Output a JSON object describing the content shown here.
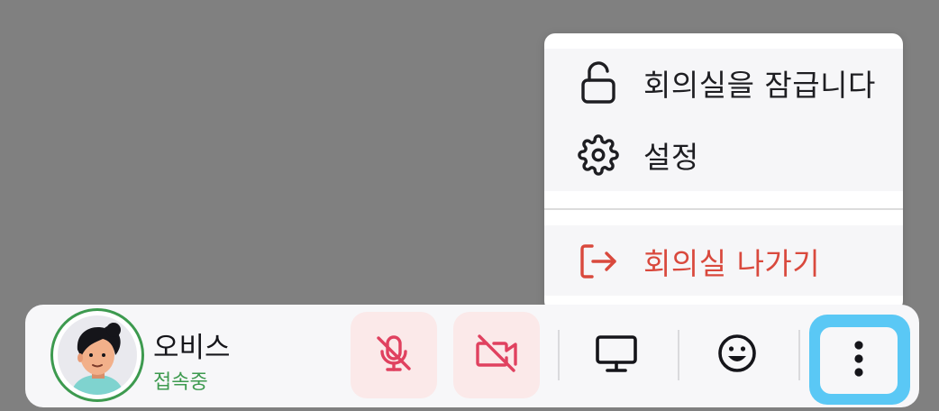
{
  "menu": {
    "items": [
      {
        "label": "회의실을 잠급니다",
        "icon": "lock-open-icon"
      },
      {
        "label": "설정",
        "icon": "gear-icon"
      },
      {
        "label": "회의실 나가기",
        "icon": "exit-icon"
      }
    ]
  },
  "user": {
    "name": "오비스",
    "status": "접속중"
  },
  "toolbar": {
    "buttons": [
      {
        "icon": "mic-off-icon",
        "state": "off"
      },
      {
        "icon": "camera-off-icon",
        "state": "off"
      },
      {
        "icon": "monitor-icon"
      },
      {
        "icon": "emoji-icon"
      },
      {
        "icon": "more-vertical-icon",
        "state": "focused"
      }
    ]
  },
  "colors": {
    "accent_focus": "#5ac8f5",
    "danger": "#d9493d",
    "online": "#3d9a4f",
    "off_button_bg": "#fbe9e9",
    "off_icon": "#e0415f"
  }
}
